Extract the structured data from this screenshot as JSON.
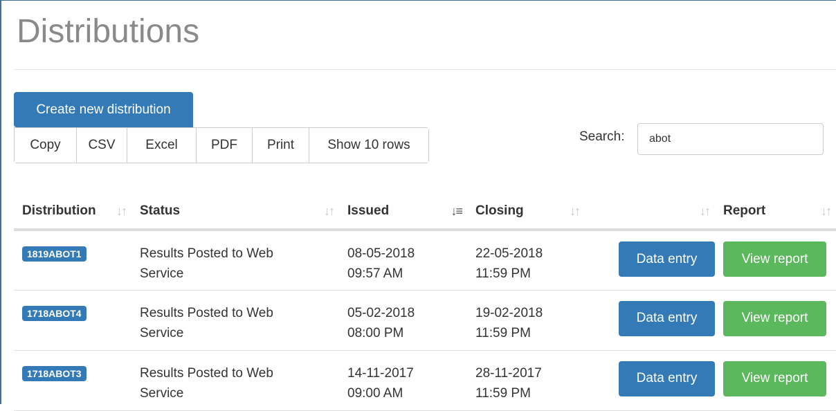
{
  "page": {
    "title": "Distributions"
  },
  "toolbar": {
    "create_label": "Create new distribution",
    "export_buttons": [
      "Copy",
      "CSV",
      "Excel",
      "PDF",
      "Print",
      "Show 10 rows"
    ]
  },
  "search": {
    "label": "Search:",
    "value": "abot"
  },
  "table": {
    "headers": [
      "Distribution",
      "Status",
      "Issued",
      "Closing",
      "",
      "Report"
    ],
    "rows": [
      {
        "distribution": "1819ABOT1",
        "status": "Results Posted to Web Service",
        "issued_date": "08-05-2018",
        "issued_time": "09:57 AM",
        "closing_date": "22-05-2018",
        "closing_time": "11:59 PM",
        "action": "Data entry",
        "report": "View report"
      },
      {
        "distribution": "1718ABOT4",
        "status": "Results Posted to Web Service",
        "issued_date": "05-02-2018",
        "issued_time": "08:00 PM",
        "closing_date": "19-02-2018",
        "closing_time": "11:59 PM",
        "action": "Data entry",
        "report": "View report"
      },
      {
        "distribution": "1718ABOT3",
        "status": "Results Posted to Web Service",
        "issued_date": "14-11-2017",
        "issued_time": "09:00 AM",
        "closing_date": "28-11-2017",
        "closing_time": "11:59 PM",
        "action": "Data entry",
        "report": "View report"
      }
    ]
  },
  "colors": {
    "primary": "#337ab7",
    "success": "#5cb85c",
    "title_gray": "#8a8a8a"
  }
}
